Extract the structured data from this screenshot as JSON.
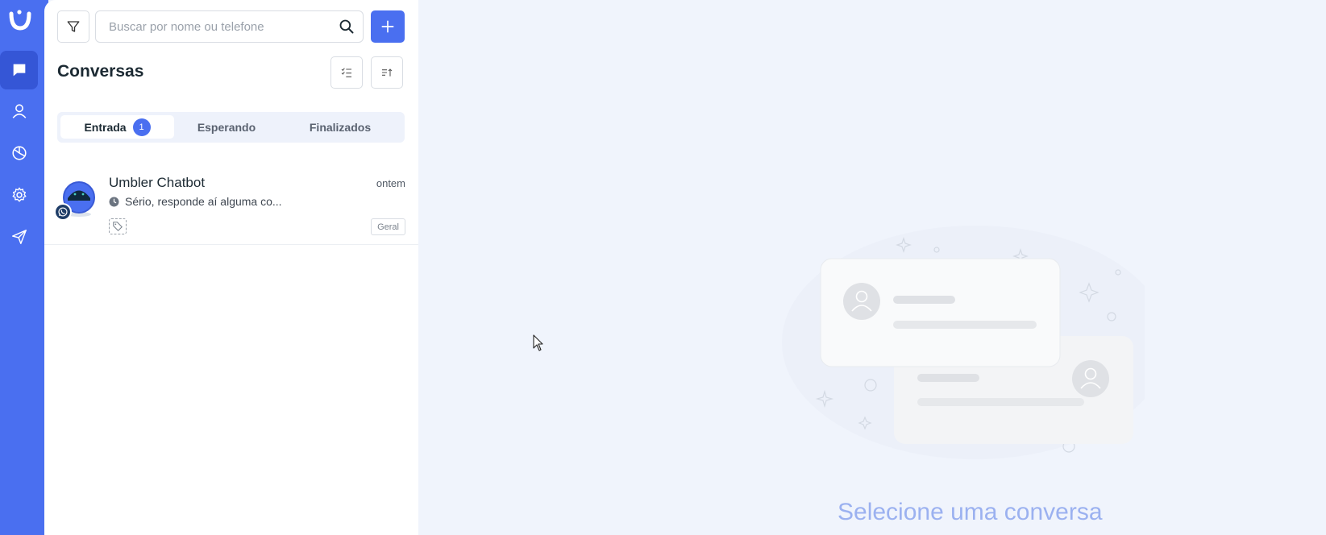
{
  "colors": {
    "accent": "#4a6ff0",
    "rail_active": "#3556d6",
    "panel_bg": "#ffffff",
    "page_bg": "#f0f4fc",
    "empty_text": "#9bb1f0"
  },
  "rail": {
    "logo": "umbler-logo-icon",
    "items": [
      {
        "icon": "chat-icon",
        "active": true
      },
      {
        "icon": "user-icon",
        "active": false
      },
      {
        "icon": "pie-chart-icon",
        "active": false
      },
      {
        "icon": "gear-icon",
        "active": false
      },
      {
        "icon": "send-icon",
        "active": false
      }
    ]
  },
  "list": {
    "filter_icon": "filter-icon",
    "search": {
      "placeholder": "Buscar por nome ou telefone",
      "value": ""
    },
    "add_icon": "plus-icon",
    "title": "Conversas",
    "select_icon": "checklist-icon",
    "sort_icon": "sort-icon",
    "tabs": [
      {
        "label": "Entrada",
        "badge": "1",
        "active": true
      },
      {
        "label": "Esperando",
        "active": false
      },
      {
        "label": "Finalizados",
        "active": false
      }
    ],
    "conversations": [
      {
        "name": "Umbler Chatbot",
        "time": "ontem",
        "message": "Sério, responde aí alguma co...",
        "channel_icon": "whatsapp-icon",
        "status_icon": "clock-icon",
        "tag_icon": "tag-icon",
        "label": "Geral"
      }
    ]
  },
  "empty_state": {
    "text": "Selecione uma conversa"
  }
}
